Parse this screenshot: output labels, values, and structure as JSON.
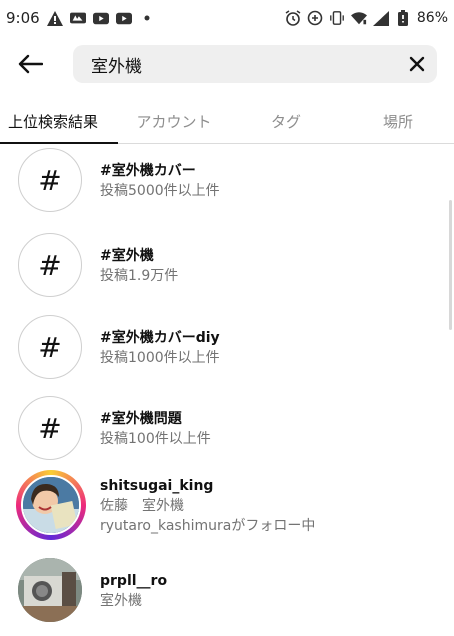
{
  "status_bar": {
    "time": "9:06",
    "battery": "86%",
    "left_icons": [
      "warning-icon",
      "news-icon",
      "youtube-icon",
      "youtube-icon",
      "dot-icon"
    ],
    "right_icons": [
      "alarm-icon",
      "data-saver-icon",
      "vibrate-icon",
      "wifi-icon",
      "signal-icon",
      "battery-icon"
    ]
  },
  "search": {
    "query": "室外機"
  },
  "tabs": [
    {
      "label": "上位検索結果",
      "active": true
    },
    {
      "label": "アカウント",
      "active": false
    },
    {
      "label": "タグ",
      "active": false
    },
    {
      "label": "場所",
      "active": false
    }
  ],
  "results": [
    {
      "type": "hashtag",
      "symbol": "#",
      "title": "#室外機カバー",
      "sub": "投稿5000件以上件"
    },
    {
      "type": "hashtag",
      "symbol": "#",
      "title": "#室外機",
      "sub": "投稿1.9万件"
    },
    {
      "type": "hashtag",
      "symbol": "#",
      "title": "#室外機カバーdiy",
      "sub": "投稿1000件以上件"
    },
    {
      "type": "hashtag",
      "symbol": "#",
      "title": "#室外機問題",
      "sub": "投稿100件以上件"
    },
    {
      "type": "account",
      "title": "shitsugai_king",
      "sub": "佐藤　室外機",
      "sub2": "ryutaro_kashimuraがフォロー中"
    },
    {
      "type": "account",
      "title": "prpll__ro",
      "sub": "室外機"
    }
  ],
  "colors": {
    "accent_text": "#111111",
    "secondary_text": "#737373",
    "search_bg": "#efefef",
    "story_ring": [
      "#f9ce34",
      "#ee2a7b",
      "#6228d7"
    ]
  }
}
